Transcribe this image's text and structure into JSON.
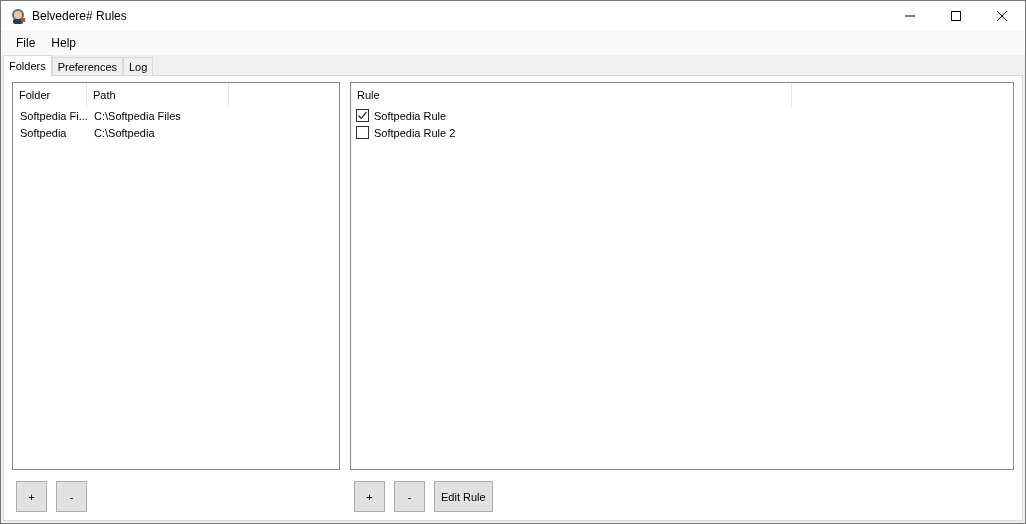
{
  "window": {
    "title": "Belvedere# Rules"
  },
  "menu": [
    "File",
    "Help"
  ],
  "tabs": [
    {
      "label": "Folders",
      "selected": true
    },
    {
      "label": "Preferences",
      "selected": false
    },
    {
      "label": "Log",
      "selected": false
    }
  ],
  "folders": {
    "columns": [
      "Folder",
      "Path"
    ],
    "rows": [
      [
        "Softpedia Fi...",
        "C:\\Softpedia Files"
      ],
      [
        "Softpedia",
        "C:\\Softpedia"
      ]
    ],
    "buttons": [
      "+",
      "-"
    ]
  },
  "rules": {
    "columns": [
      "Rule"
    ],
    "rows": [
      {
        "label": "Softpedia Rule",
        "checked": true
      },
      {
        "label": "Softpedia Rule 2",
        "checked": false
      }
    ],
    "buttons": [
      "+",
      "-",
      "Edit Rule"
    ]
  }
}
